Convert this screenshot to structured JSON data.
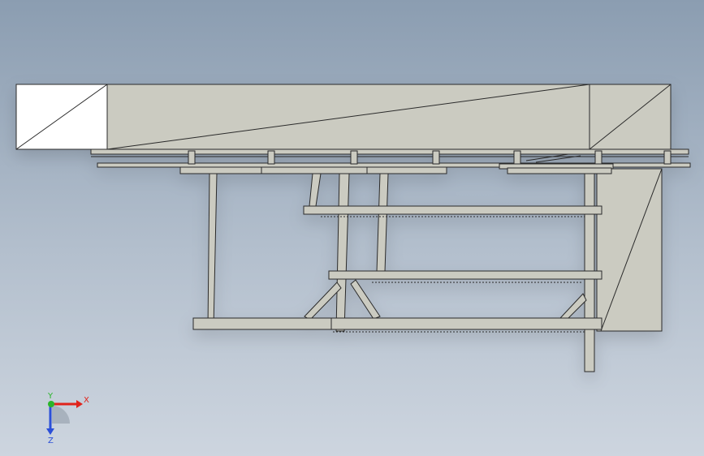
{
  "viewport": {
    "background_top": "#8b9db1",
    "background_bottom": "#cdd5df"
  },
  "model": {
    "face_color": "#cbcbc1",
    "edge_color": "#2a2a2a",
    "white_face_color": "#ffffff"
  },
  "triad": {
    "x_label": "X",
    "y_label": "Y",
    "z_label": "Z",
    "x_color": "#e0231b",
    "y_color": "#2ab52a",
    "z_color": "#2b4fd8"
  }
}
